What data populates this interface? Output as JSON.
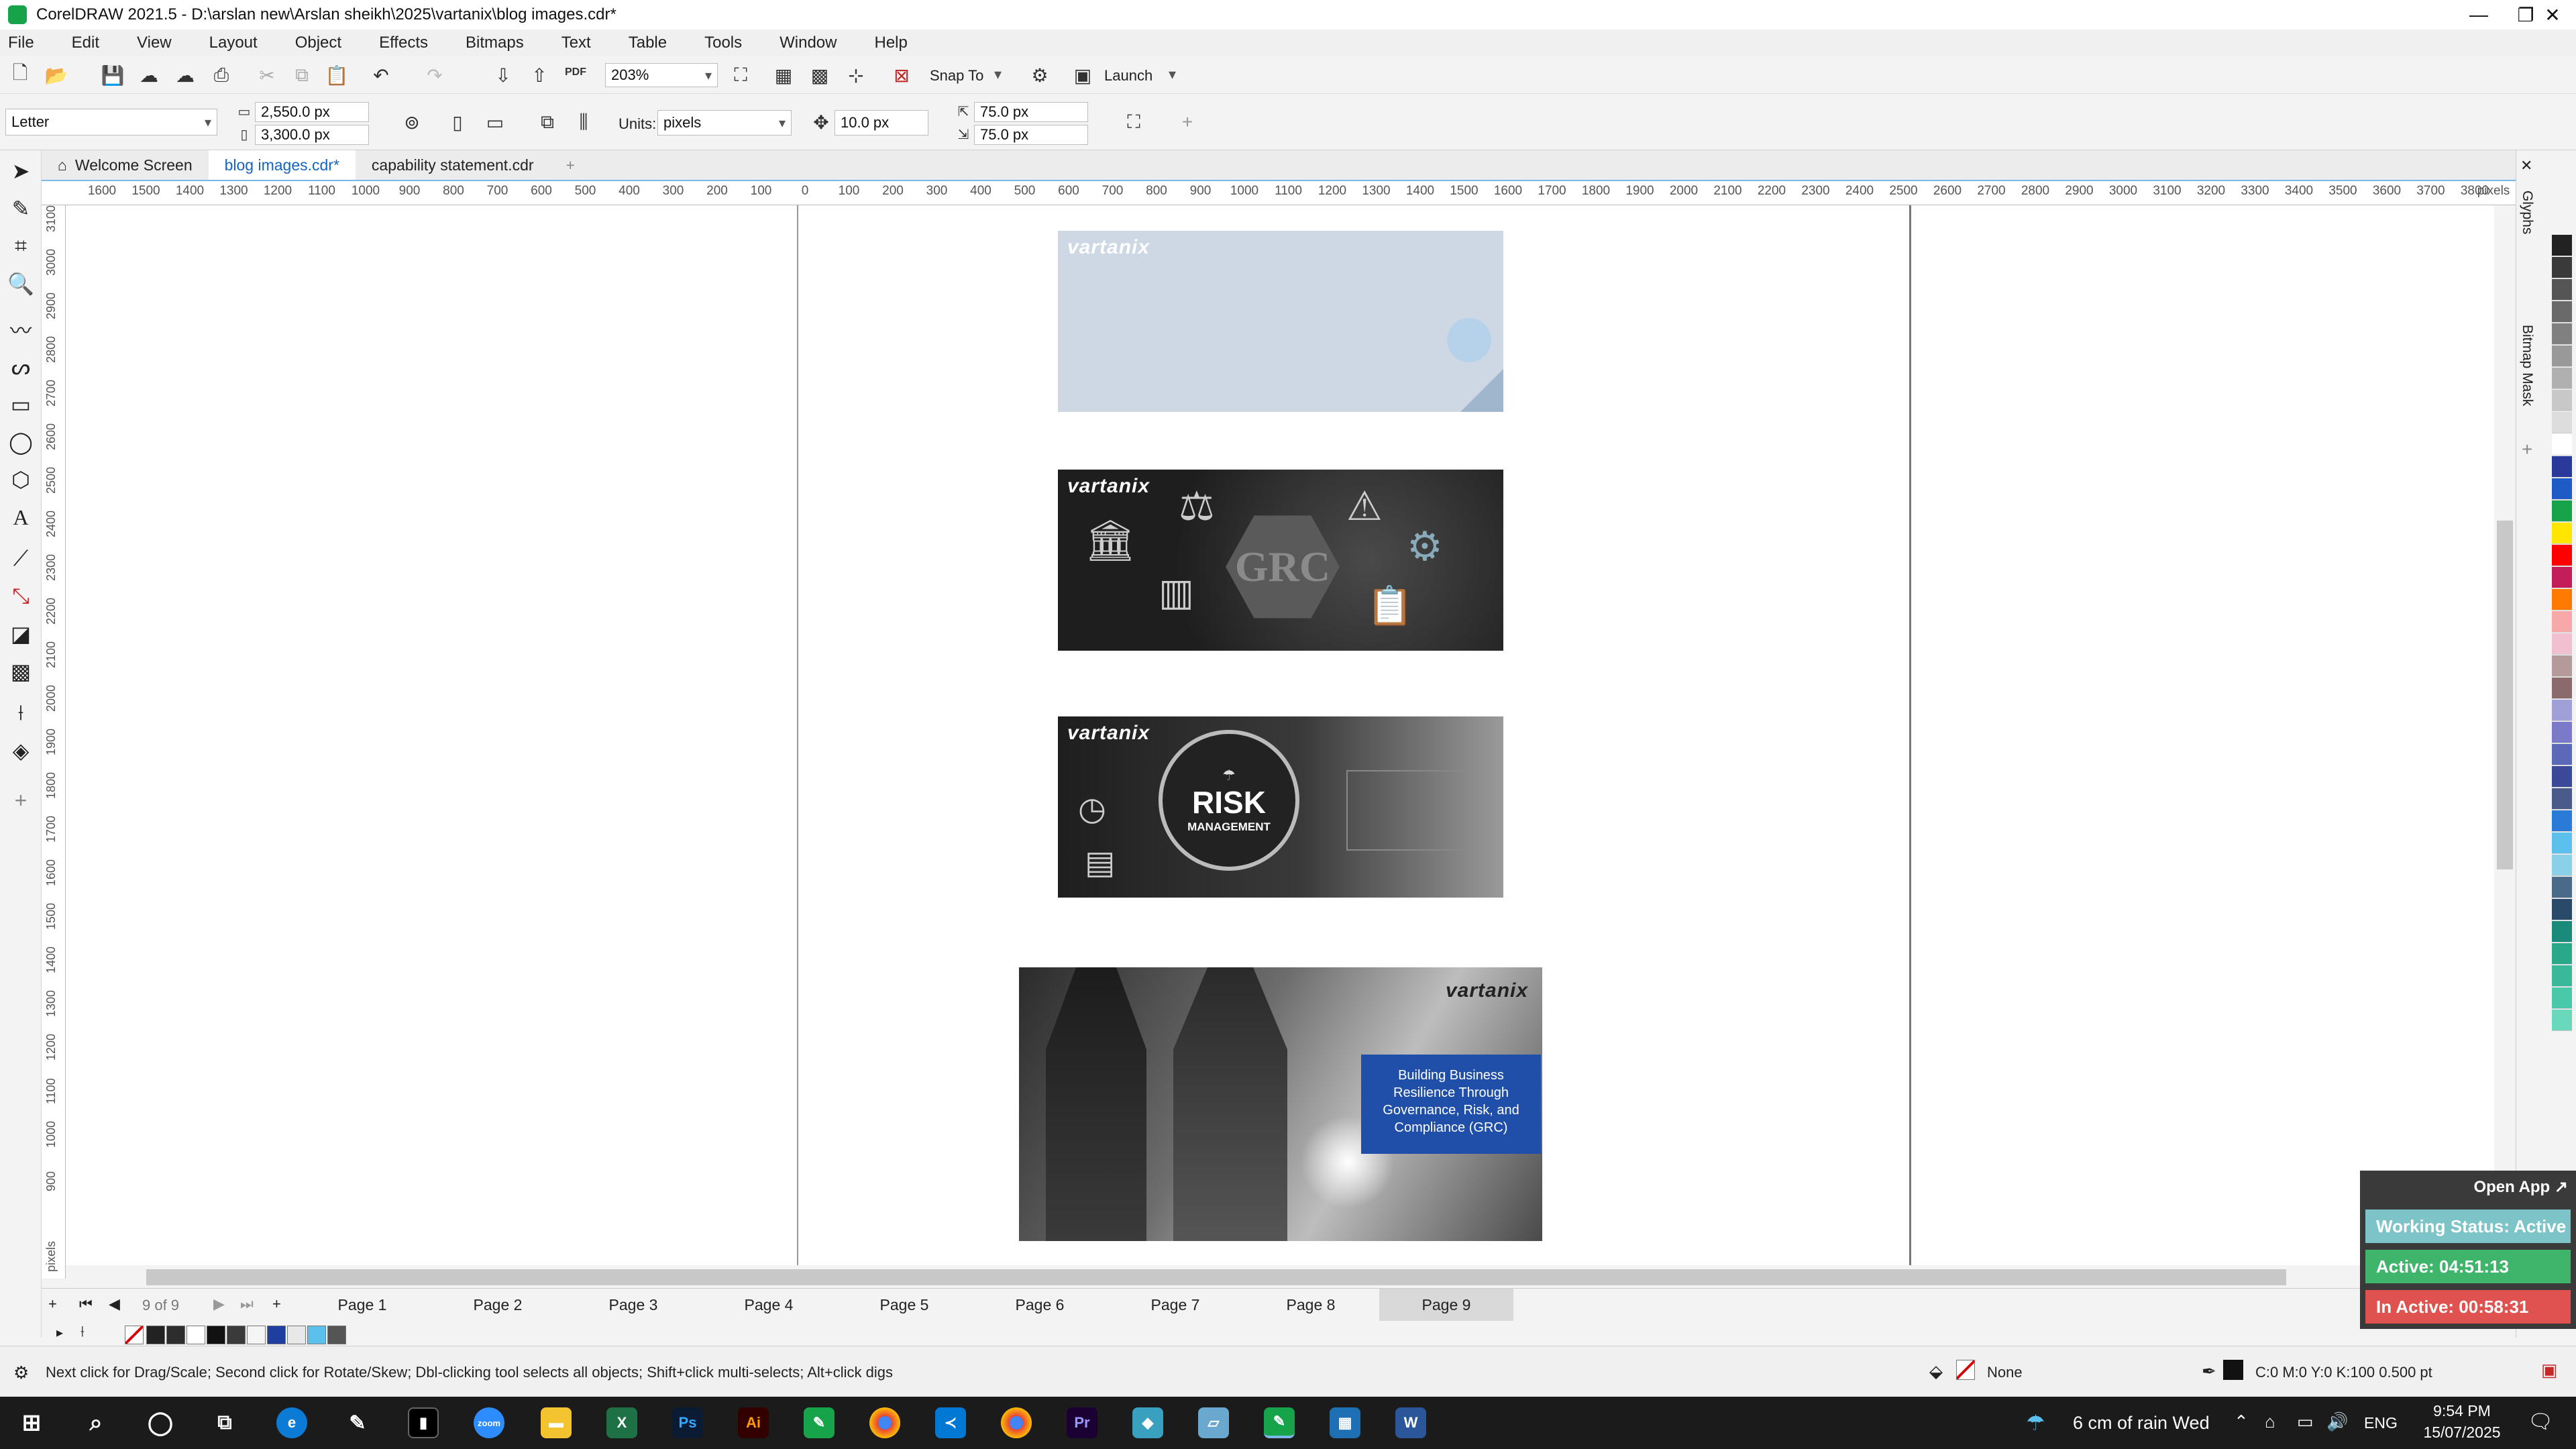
{
  "window": {
    "title": "CorelDRAW 2021.5 - D:\\arslan new\\Arslan sheikh\\2025\\vartanix\\blog images.cdr*",
    "controls": [
      "—",
      "❐",
      "✕"
    ]
  },
  "menu": [
    "File",
    "Edit",
    "View",
    "Layout",
    "Object",
    "Effects",
    "Bitmaps",
    "Text",
    "Table",
    "Tools",
    "Window",
    "Help"
  ],
  "toolbar": {
    "zoom": "203%",
    "snap_label": "Snap To",
    "launch_label": "Launch",
    "pdf_label": "PDF"
  },
  "propertybar": {
    "page_size": "Letter",
    "width": "2,550.0 px",
    "height": "3,300.0 px",
    "units_label": "Units:",
    "units_value": "pixels",
    "nudge": "10.0 px",
    "dup_x": "75.0 px",
    "dup_y": "75.0 px"
  },
  "doc_tabs": [
    {
      "label": "Welcome Screen",
      "active": false
    },
    {
      "label": "blog images.cdr*",
      "active": true
    },
    {
      "label": "capability statement.cdr",
      "active": false
    }
  ],
  "ruler": {
    "h_ticks": [
      "1600",
      "1500",
      "1400",
      "1300",
      "1200",
      "1100",
      "1000",
      "900",
      "800",
      "700",
      "600",
      "500",
      "400",
      "300",
      "200",
      "100",
      "0",
      "100",
      "200",
      "300",
      "400",
      "500",
      "600",
      "700",
      "800",
      "900",
      "1000",
      "1100",
      "1200",
      "1300",
      "1400",
      "1500",
      "1600",
      "1700",
      "1800",
      "1900",
      "2000",
      "2100",
      "2200",
      "2300",
      "2400",
      "2500",
      "2600",
      "2700",
      "2800",
      "2900",
      "3000",
      "3100",
      "3200",
      "3300",
      "3400",
      "3500",
      "3600",
      "3700",
      "3800"
    ],
    "h_unit": "pixels",
    "v_ticks": [
      "3100",
      "3000",
      "2900",
      "2800",
      "2700",
      "2600",
      "2500",
      "2400",
      "2300",
      "2200",
      "2100",
      "2000",
      "1900",
      "1800",
      "1700",
      "1600",
      "1500",
      "1400",
      "1300",
      "1200",
      "1100",
      "1000",
      "900"
    ],
    "v_unit": "pixels"
  },
  "artboards": {
    "brand": "vartanix",
    "img2_text": "GRC",
    "img3_title": "RISK",
    "img3_subtitle": "MANAGEMENT",
    "img4_caption": "Building Business Resilience Through Governance, Risk, and Compliance (GRC)"
  },
  "pages": {
    "counter": "9 of 9",
    "tabs": [
      "Page 1",
      "Page 2",
      "Page 3",
      "Page 4",
      "Page 5",
      "Page 6",
      "Page 7",
      "Page 8",
      "Page 9"
    ],
    "active": "Page 9"
  },
  "dockers": {
    "glyphs": "Glyphs",
    "bitmap_mask": "Bitmap Mask"
  },
  "status": {
    "hint": "Next click for Drag/Scale; Second click for Rotate/Skew; Dbl-clicking tool selects all objects; Shift+click multi-selects; Alt+click digs",
    "fill": "None",
    "outline": "C:0 M:0 Y:0 K:100  0.500 pt"
  },
  "widget": {
    "open_app": "Open App ↗",
    "working": "Working Status: Active",
    "active": "Active: 04:51:13",
    "inactive": "In Active: 00:58:31"
  },
  "taskbar": {
    "weather": "6 cm of rain Wed",
    "lang": "ENG",
    "time": "9:54 PM",
    "date": "15/07/2025",
    "apps": [
      "zoom",
      "Ps",
      "Ai",
      "Pr",
      "W"
    ]
  },
  "colors": {
    "accent": "#1565c0",
    "working_bg": "#7cc4c8",
    "active_bg": "#3fb56c",
    "inactive_bg": "#e0524f",
    "caption_bg": "#1f4fa8"
  }
}
